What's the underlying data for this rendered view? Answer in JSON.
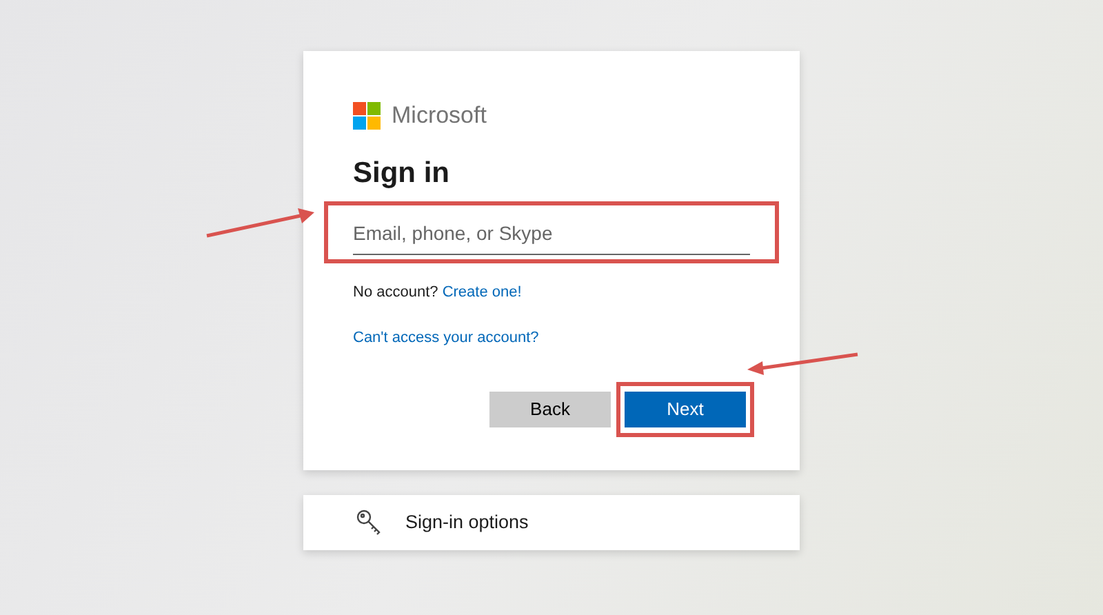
{
  "brand": {
    "name": "Microsoft"
  },
  "title": "Sign in",
  "email_field": {
    "placeholder": "Email, phone, or Skype",
    "highlighted": true
  },
  "no_account": {
    "text": "No account?",
    "link": "Create one!"
  },
  "access_link": "Can't access your account?",
  "buttons": [
    {
      "label": "Back",
      "kind": "secondary",
      "highlighted": false
    },
    {
      "label": "Next",
      "kind": "primary",
      "highlighted": true
    }
  ],
  "options": {
    "label": "Sign-in options"
  }
}
